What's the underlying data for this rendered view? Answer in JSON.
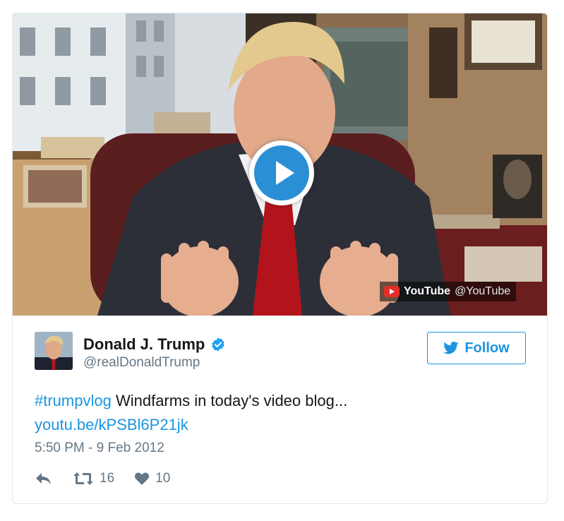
{
  "media": {
    "provider_brand": "YouTube",
    "provider_handle": "@YouTube",
    "play_icon": "play-icon"
  },
  "user": {
    "name": "Donald J. Trump",
    "handle": "@realDonaldTrump",
    "verified_icon": "verified-badge-icon"
  },
  "follow": {
    "label": "Follow",
    "icon": "twitter-bird-icon"
  },
  "tweet": {
    "hashtag": "#trumpvlog",
    "text": " Windfarms in today's video blog...",
    "link": "youtu.be/kPSBl6P21jk",
    "timestamp": "5:50 PM - 9 Feb 2012"
  },
  "actions": {
    "reply_icon": "reply-icon",
    "retweet_icon": "retweet-icon",
    "retweet_count": "16",
    "like_icon": "heart-icon",
    "like_count": "10"
  },
  "colors": {
    "accent": "#1b95e0",
    "play": "#2b8fd6",
    "youtube_red": "#e52d27",
    "muted": "#657786"
  }
}
